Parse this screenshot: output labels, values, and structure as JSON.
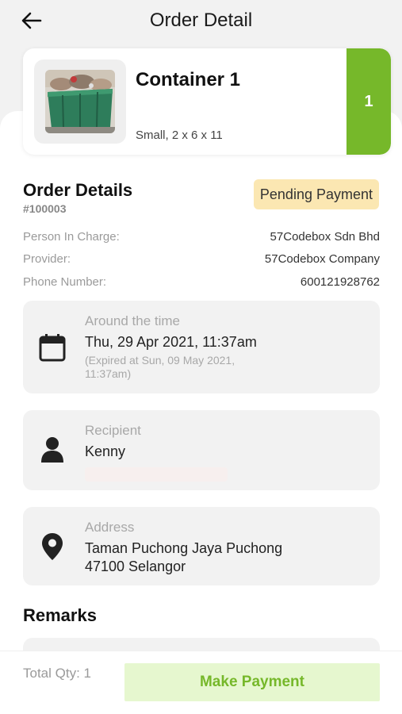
{
  "header": {
    "title": "Order Detail"
  },
  "product": {
    "name": "Container 1",
    "spec": "Small, 2 x 6 x 11",
    "qty": "1"
  },
  "order": {
    "section_title": "Order Details",
    "number": "#100003",
    "status": "Pending Payment",
    "status_color": "#fbe7b2",
    "details": [
      {
        "label": "Person In Charge:",
        "value": "57Codebox Sdn Bhd"
      },
      {
        "label": "Provider:",
        "value": "57Codebox Company"
      },
      {
        "label": "Phone Number:",
        "value": "600121928762"
      }
    ]
  },
  "schedule": {
    "label": "Around the time",
    "value": "Thu, 29 Apr 2021, 11:37am",
    "expiry": "(Expired at Sun, 09 May 2021, 11:37am)",
    "icon": "calendar-icon"
  },
  "recipient": {
    "label": "Recipient",
    "value": "Kenny",
    "icon": "person-icon"
  },
  "address": {
    "label": "Address",
    "line1": "Taman Puchong Jaya  Puchong",
    "line2": "47100 Selangor",
    "icon": "location-pin-icon"
  },
  "remarks": {
    "title": "Remarks"
  },
  "footer": {
    "total_qty": "Total Qty: 1",
    "pay_label": "Make Payment"
  },
  "colors": {
    "accent": "#76b82a",
    "pay_button_bg": "#e6f7cf"
  }
}
